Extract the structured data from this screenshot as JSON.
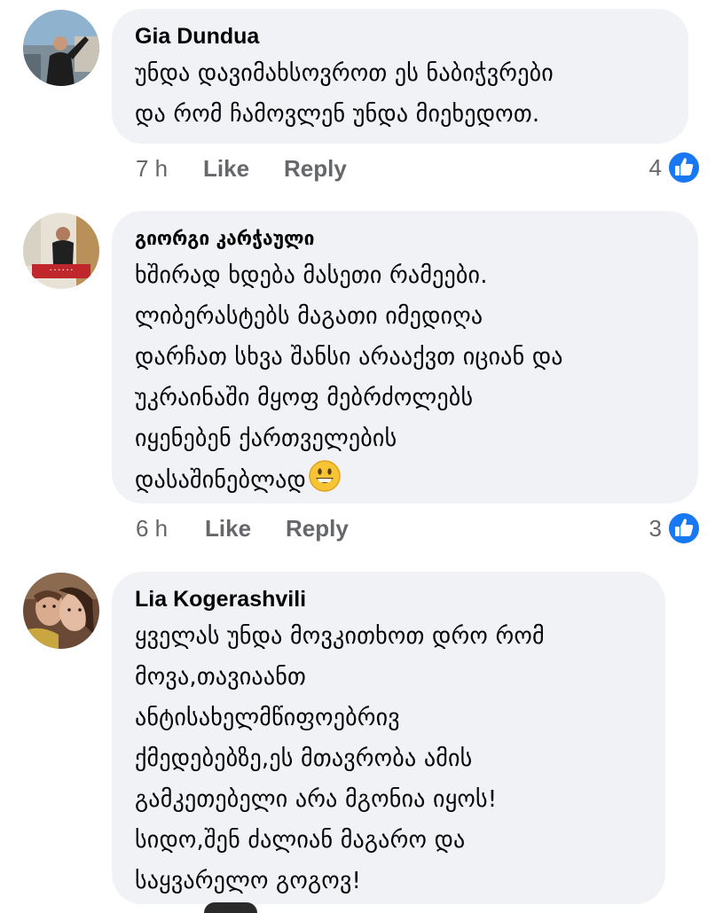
{
  "comments": [
    {
      "author": "Gia Dundua",
      "text": "უნდა დავიმახსოვროთ ეს ნაბიჭვრები\nდა რომ ჩამოვლენ უნდა მიეხედოთ.",
      "time": "7 h",
      "like_label": "Like",
      "reply_label": "Reply",
      "reaction_count": "4",
      "reaction_icon": "like-icon"
    },
    {
      "author": "გიორგი კარჭაული",
      "text": "ხშირად ხდება მასეთი რამეები.\nლიბერასტებს მაგათი იმედიღა\nდარჩათ სხვა შანსი არააქვთ იციან და\nუკრაინაში მყოფ მებრძოლებს\nიყენებენ ქართველების\nდასაშინებლად",
      "emoji": "grinning-face-emoji",
      "time": "6 h",
      "like_label": "Like",
      "reply_label": "Reply",
      "reaction_count": "3",
      "reaction_icon": "like-icon"
    },
    {
      "author": "Lia Kogerashvili",
      "text": "ყველას უნდა მოვკითხოთ დრო რომ\nმოვა,თავიაანთ\nანტისახელმწიფოებრივ\nქმედებებზე,ეს მთავრობა ამის\nგამკეთებელი არა მგონია იყოს!\nსიდო,შენ ძალიან მაგარო და\nსაყვარელო გოგოვ!"
    }
  ],
  "colors": {
    "bubble": "#f0f2f5",
    "secondary_text": "#65676b",
    "like_blue": "#1877f2"
  }
}
